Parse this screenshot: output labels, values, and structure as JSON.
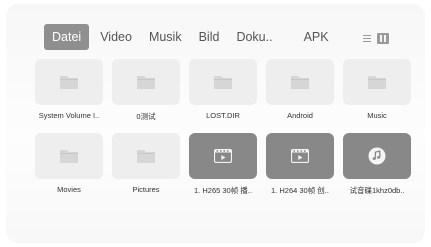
{
  "tabs": [
    {
      "label": "Datei",
      "active": true
    },
    {
      "label": "Video",
      "active": false
    },
    {
      "label": "Musik",
      "active": false
    },
    {
      "label": "Bild",
      "active": false
    },
    {
      "label": "Doku..",
      "active": false
    },
    {
      "label": "APK",
      "active": false
    }
  ],
  "view_mode": {
    "list_icon": "list-icon",
    "grid_icon": "grid-icon",
    "selected": "grid"
  },
  "files": [
    {
      "name": "System Volume I..",
      "type": "folder",
      "icon": "folder-icon"
    },
    {
      "name": "0测试",
      "type": "folder",
      "icon": "folder-icon"
    },
    {
      "name": "LOST.DIR",
      "type": "folder",
      "icon": "folder-icon"
    },
    {
      "name": "Android",
      "type": "folder",
      "icon": "folder-icon"
    },
    {
      "name": "Music",
      "type": "folder",
      "icon": "folder-icon"
    },
    {
      "name": "Movies",
      "type": "folder",
      "icon": "folder-icon"
    },
    {
      "name": "Pictures",
      "type": "folder",
      "icon": "folder-icon"
    },
    {
      "name": "1. H265 30帧 播..",
      "type": "video",
      "icon": "video-file-icon"
    },
    {
      "name": "1. H264 30帧 创..",
      "type": "video",
      "icon": "video-file-icon"
    },
    {
      "name": "试音碟1khz0db..",
      "type": "audio",
      "icon": "music-note-icon"
    }
  ],
  "colors": {
    "tab_active_bg": "#8f8f8f",
    "tile_light": "#eeeeee",
    "tile_dark": "#888888",
    "folder_icon": "#d9d9d9"
  }
}
